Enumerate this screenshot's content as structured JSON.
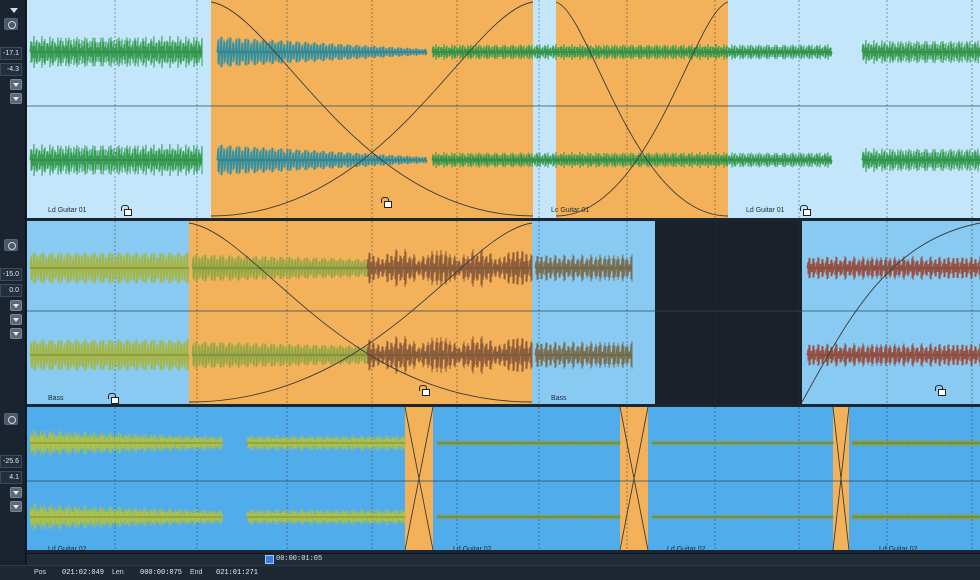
{
  "tracks": [
    {
      "name": "Ld Guitar 01",
      "controls": {
        "value_a": "-17.1",
        "value_b": "-4.3"
      },
      "clip_labels": [
        "Ld Guitar 01",
        "Lc Guitar 01",
        "Ld Guitar 01"
      ]
    },
    {
      "name": "Bass",
      "controls": {
        "value_a": "-15.0",
        "value_b": "0.0"
      },
      "clip_labels": [
        "Bass",
        "Bass"
      ]
    },
    {
      "name": "Ld Guitar 02",
      "controls": {
        "value_a": "-25.6",
        "value_b": "4.1"
      },
      "clip_labels": [
        "Ld Guitar 02",
        "Ld Guitar 02",
        "Ld Guitar 02",
        "Ld Guitar 02"
      ]
    }
  ],
  "transport": {
    "time": "00:00:01:05"
  },
  "status": {
    "pos_label": "Pos",
    "pos_value": "021:02:049",
    "len_label": "Len",
    "len_value": "000:00:075",
    "end_label": "End",
    "end_value": "021:01:271"
  },
  "colors": {
    "crossfade": "#f3b25a",
    "track1_bg": "#c3e6fa",
    "track2_bg": "#89caf2",
    "track3_bg": "#51aceb",
    "mute_region": "#1c2028"
  }
}
